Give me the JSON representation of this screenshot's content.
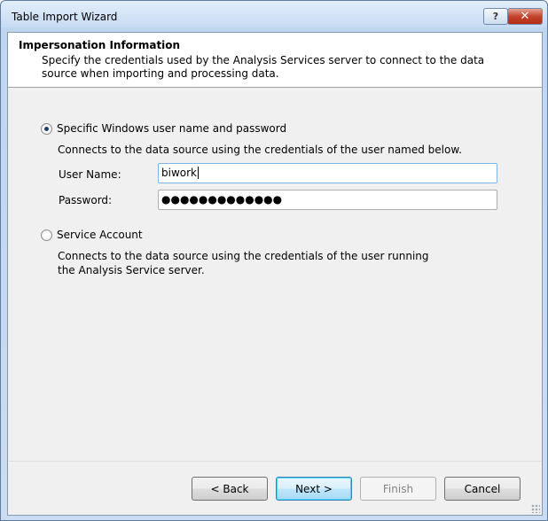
{
  "window": {
    "title": "Table Import Wizard",
    "help_glyph": "?",
    "close_glyph": "✕"
  },
  "header": {
    "title": "Impersonation Information",
    "description": "Specify the credentials used by the Analysis Services server to connect to the data source when importing and processing data."
  },
  "options": {
    "specific": {
      "label": "Specific Windows user name and password",
      "selected": true,
      "description": "Connects to the data source using the credentials of the user named below.",
      "username_label": "User Name:",
      "username_value": "biwork",
      "password_label": "Password:",
      "password_value": "●●●●●●●●●●●●●"
    },
    "service": {
      "label": "Service Account",
      "selected": false,
      "description": "Connects to the data source using the credentials of the user running the Analysis Service server."
    }
  },
  "buttons": {
    "back": "< Back",
    "next": "Next >",
    "finish": "Finish",
    "cancel": "Cancel"
  }
}
